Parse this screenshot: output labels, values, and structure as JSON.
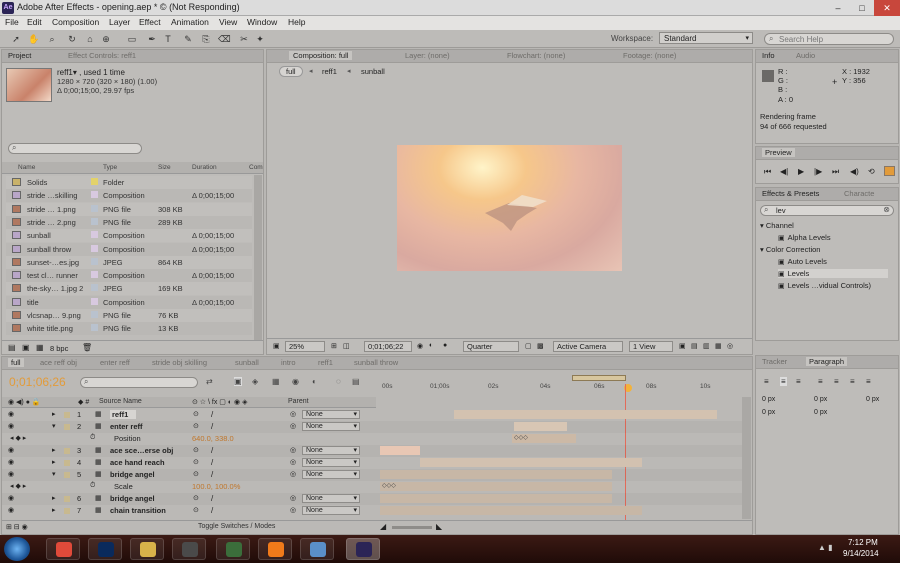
{
  "window": {
    "title": "Adobe After Effects - opening.aep * © (Not Responding)",
    "app_icon_label": "Ae"
  },
  "window_controls": {
    "minimize": "–",
    "maximize": "□",
    "close": "✕"
  },
  "menu": [
    "File",
    "Edit",
    "Composition",
    "Layer",
    "Effect",
    "Animation",
    "View",
    "Window",
    "Help"
  ],
  "toolbar": {
    "tools": [
      "selection-icon",
      "hand-icon",
      "zoom-icon",
      "rotate-icon",
      "camera-icon",
      "pan-behind-icon",
      "rectangle-icon",
      "pen-icon",
      "type-icon",
      "brush-icon",
      "clone-stamp-icon",
      "eraser-icon",
      "roto-brush-icon",
      "puppet-pin-icon"
    ],
    "workspace_label": "Workspace:",
    "workspace_value": "Standard",
    "search_placeholder": "Search Help"
  },
  "project_panel": {
    "tabs": [
      "Project",
      "Effect Controls: reff1"
    ],
    "selected_name": "reff1▾ , used 1 time",
    "selected_size": "1280 × 720  (320 × 180) (1.00)",
    "selected_duration": "Δ 0;00;15;00, 29.97 fps",
    "columns": [
      "Name",
      "Type",
      "Size",
      "Duration",
      "Com"
    ],
    "items": [
      {
        "name": "Solids",
        "type": "Folder",
        "size": "",
        "duration": "",
        "icon": "folder",
        "swatch": "#e3d26a"
      },
      {
        "name": "stride …skilling",
        "type": "Composition",
        "size": "",
        "duration": "Δ 0;00;15;00",
        "icon": "comp",
        "swatch": "#d8c9e0"
      },
      {
        "name": "stride … 1.png",
        "type": "PNG file",
        "size": "308 KB",
        "duration": "",
        "icon": "img",
        "swatch": "#b9c2ce"
      },
      {
        "name": "stride … 2.png",
        "type": "PNG file",
        "size": "289 KB",
        "duration": "",
        "icon": "img",
        "swatch": "#b9c2ce"
      },
      {
        "name": "sunball",
        "type": "Composition",
        "size": "",
        "duration": "Δ 0;00;15;00",
        "icon": "comp",
        "swatch": "#d8c9e0"
      },
      {
        "name": "sunball throw",
        "type": "Composition",
        "size": "",
        "duration": "Δ 0;00;15;00",
        "icon": "comp",
        "swatch": "#d8c9e0"
      },
      {
        "name": "sunset-…es.jpg",
        "type": "JPEG",
        "size": "864 KB",
        "duration": "",
        "icon": "img",
        "swatch": "#b9c2ce"
      },
      {
        "name": "test cl… runner",
        "type": "Composition",
        "size": "",
        "duration": "Δ 0;00;15;00",
        "icon": "comp",
        "swatch": "#d8c9e0"
      },
      {
        "name": "the-sky… 1.jpg 2",
        "type": "JPEG",
        "size": "169 KB",
        "duration": "",
        "icon": "img",
        "swatch": "#b9c2ce"
      },
      {
        "name": "title",
        "type": "Composition",
        "size": "",
        "duration": "Δ 0;00;15;00",
        "icon": "comp",
        "swatch": "#d8c9e0"
      },
      {
        "name": "vlcsnap… 9.png",
        "type": "PNG file",
        "size": "76 KB",
        "duration": "",
        "icon": "img",
        "swatch": "#b9c2ce"
      },
      {
        "name": "white title.png",
        "type": "PNG file",
        "size": "13 KB",
        "duration": "",
        "icon": "img",
        "swatch": "#b9c2ce"
      }
    ],
    "bpc": "8 bpc"
  },
  "composition_panel": {
    "tabs": [
      "Composition: full",
      "Layer: (none)",
      "Flowchart: (none)",
      "Footage: (none)"
    ],
    "breadcrumbs": [
      "full",
      "reff1",
      "sunball"
    ],
    "zoom": "25%",
    "timecode": "0;01;06;22",
    "resolution": "Quarter",
    "camera": "Active Camera",
    "view": "1 View"
  },
  "info_panel": {
    "tabs": [
      "Info",
      "Audio"
    ],
    "r": "R :",
    "g": "G :",
    "b": "B :",
    "a": "A :  0",
    "x": "X : 1932",
    "y": "Y : 356",
    "status_line1": "Rendering frame",
    "status_line2": "94 of 666 requested"
  },
  "preview_panel": {
    "tab": "Preview"
  },
  "effects_panel": {
    "tabs": [
      "Effects & Presets",
      "Characte"
    ],
    "search_value": "lev",
    "tree": [
      {
        "label": "▾ Channel",
        "indent": 0,
        "selected": false
      },
      {
        "label": "Alpha Levels",
        "indent": 1,
        "selected": false
      },
      {
        "label": "▾ Color Correction",
        "indent": 0,
        "selected": false
      },
      {
        "label": "Auto Levels",
        "indent": 1,
        "selected": false
      },
      {
        "label": "Levels",
        "indent": 1,
        "selected": true
      },
      {
        "label": "Levels …vidual Controls)",
        "indent": 1,
        "selected": false
      }
    ]
  },
  "paragraph_panel": {
    "tabs": [
      "Tracker",
      "Paragraph"
    ],
    "fields": [
      "0 px",
      "0 px",
      "0 px",
      "0 px",
      "0 px"
    ]
  },
  "timeline": {
    "tabs": [
      "full",
      "ace reff obj",
      "enter reff",
      "stride obj skilling",
      "sunball",
      "intro",
      "reff1",
      "sunball throw"
    ],
    "timecode": "0;01;06;26",
    "ruler": [
      "00s",
      "01;00s",
      "02s",
      "04s",
      "06s",
      "08s",
      "10s"
    ],
    "header_source": "Source Name",
    "header_parent": "Parent",
    "rows": [
      {
        "num": "1",
        "name": "reff1",
        "kind": "layer",
        "parent": "None",
        "expanded": false,
        "selected": true
      },
      {
        "num": "2",
        "name": "enter reff",
        "kind": "layer",
        "parent": "None",
        "expanded": true,
        "selected": false
      },
      {
        "num": "",
        "name": "Position",
        "kind": "prop",
        "value": "640.0, 338.0"
      },
      {
        "num": "3",
        "name": "ace sce…erse obj",
        "kind": "layer",
        "parent": "None",
        "expanded": false,
        "selected": false
      },
      {
        "num": "4",
        "name": "ace hand reach",
        "kind": "layer",
        "parent": "None",
        "expanded": false,
        "selected": false
      },
      {
        "num": "5",
        "name": "bridge angel",
        "kind": "layer",
        "parent": "None",
        "expanded": true,
        "selected": false
      },
      {
        "num": "",
        "name": "Scale",
        "kind": "prop",
        "value": "100.0, 100.0%"
      },
      {
        "num": "6",
        "name": "bridge angel",
        "kind": "layer",
        "parent": "None",
        "expanded": false,
        "selected": false
      },
      {
        "num": "7",
        "name": "chain transition",
        "kind": "layer",
        "parent": "None",
        "expanded": false,
        "selected": false
      }
    ],
    "toggle_label": "Toggle Switches / Modes"
  },
  "taskbar": {
    "apps": [
      "Chrome",
      "Photoshop",
      "Explorer",
      "Media Center",
      "Vid Converter",
      "VLC",
      "Snipping",
      "After Effects"
    ],
    "clock_time": "7:12 PM",
    "clock_date": "9/14/2014"
  },
  "colors": {
    "ps": "#0a2a5c",
    "ae": "#2b2456",
    "accent_time": "#e29b3a",
    "selected_label": "#8ab0d8"
  }
}
